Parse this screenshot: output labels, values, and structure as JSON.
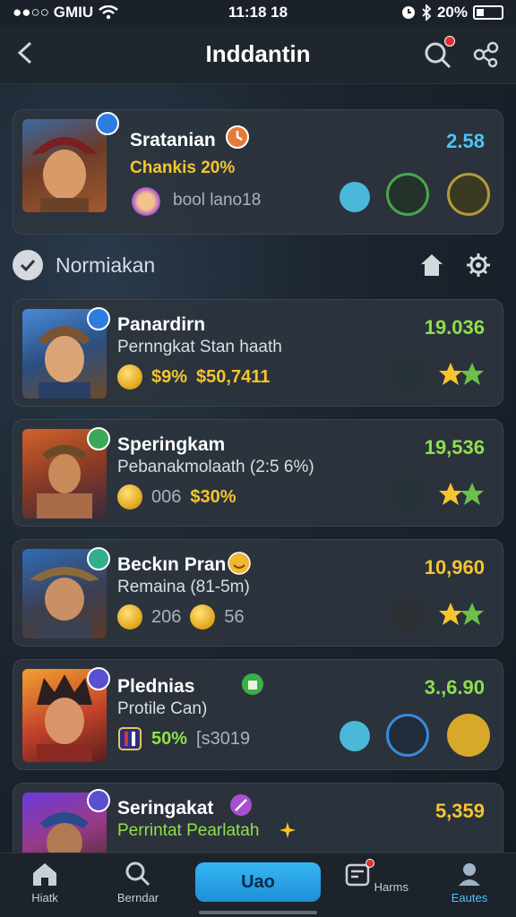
{
  "status_bar": {
    "carrier": "●●○○ GMIU",
    "time": "11:18 18",
    "battery": "20%"
  },
  "header": {
    "title": "Inddantin"
  },
  "top_card": {
    "name": "Sratanian",
    "subtitle": "Chankis 20%",
    "meta": "bool lano18",
    "score": "2.58",
    "colors": {
      "subtitle": "#f5c52d",
      "score": "#4fc3f7"
    }
  },
  "section": {
    "title": "Normiakan"
  },
  "players": [
    {
      "name": "Panardirn",
      "subtitle": "Pernngkat Stan haath",
      "stat_a": "$9%",
      "stat_b": "$50,7411",
      "score": "19.036",
      "score_color": "#8ee04a"
    },
    {
      "name": "Speringkam",
      "subtitle": "Pebanakmolaath (2:5 6%)",
      "stat_a": "006",
      "stat_b": "$30%",
      "score": "19,536",
      "score_color": "#8ee04a"
    },
    {
      "name": "Beckın Pran",
      "subtitle": "Remaina (81-5m)",
      "stat_a": "206",
      "stat_b": "56",
      "score": "10,960",
      "score_color": "#f5c52d"
    },
    {
      "name": "Plednias",
      "subtitle": "Protile Can)",
      "stat_a": "50%",
      "stat_b": "[s3019",
      "score": "3.,6.90",
      "score_color": "#8ee04a"
    },
    {
      "name": "Seringakat",
      "subtitle": "Perrintat Pearlatah",
      "score": "5,359",
      "score_color": "#f5c52d"
    }
  ],
  "bottom_nav": {
    "items": [
      "Hiatk",
      "Berndar",
      "Uao",
      "Harms",
      "Eautes"
    ],
    "active_color": "#4fc3f7"
  }
}
